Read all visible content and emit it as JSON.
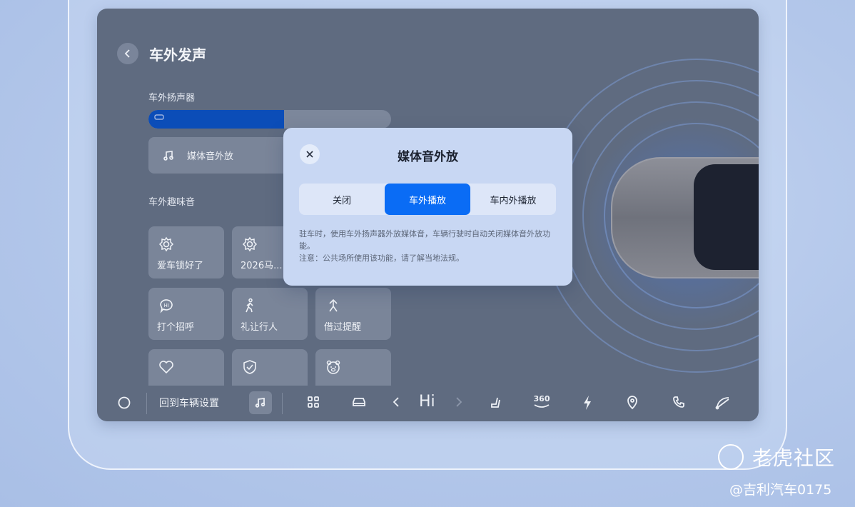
{
  "page": {
    "title": "车外发声",
    "speaker_section": "车外扬声器",
    "speaker_fill_ratio": 0.56,
    "media_item": "媒体音外放",
    "fun_section": "车外趣味音",
    "tiles": [
      {
        "label": "爱车锁好了",
        "icon": "gear-icon"
      },
      {
        "label": "2026马...",
        "icon": "gear-icon"
      },
      {
        "label": "打个招呼",
        "icon": "hi-bubble-icon"
      },
      {
        "label": "礼让行人",
        "icon": "pedestrian-icon"
      },
      {
        "label": "借过提醒",
        "icon": "merge-arrow-icon"
      },
      {
        "label": "",
        "icon": "heart-icon"
      },
      {
        "label": "",
        "icon": "shield-check-icon"
      },
      {
        "label": "",
        "icon": "bear-icon"
      }
    ]
  },
  "dock": {
    "return_label": "回到车辆设置",
    "hi_label": "Hi",
    "icons": [
      "home-circle-icon",
      "music-icon",
      "apps-grid-icon",
      "car-icon",
      "chevron-left-icon",
      "chevron-right-icon",
      "seat-icon",
      "360-camera-icon",
      "charging-icon",
      "location-pin-icon",
      "phone-icon",
      "wiper-icon"
    ],
    "cam_label": "360"
  },
  "modal": {
    "title": "媒体音外放",
    "options": [
      "关闭",
      "车外播放",
      "车内外播放"
    ],
    "selected": "车外播放",
    "desc_line1": "驻车时，使用车外扬声器外放媒体音，车辆行驶时自动关闭媒体音外放功能。",
    "desc_line2": "注意：公共场所使用该功能，请了解当地法规。"
  },
  "watermark": {
    "brand": "老虎社区",
    "credit": "@吉利汽车0175"
  },
  "colors": {
    "accent": "#0a6cf5",
    "screen_bg": "#5f6b80",
    "modal_bg": "#c8d7f3"
  }
}
